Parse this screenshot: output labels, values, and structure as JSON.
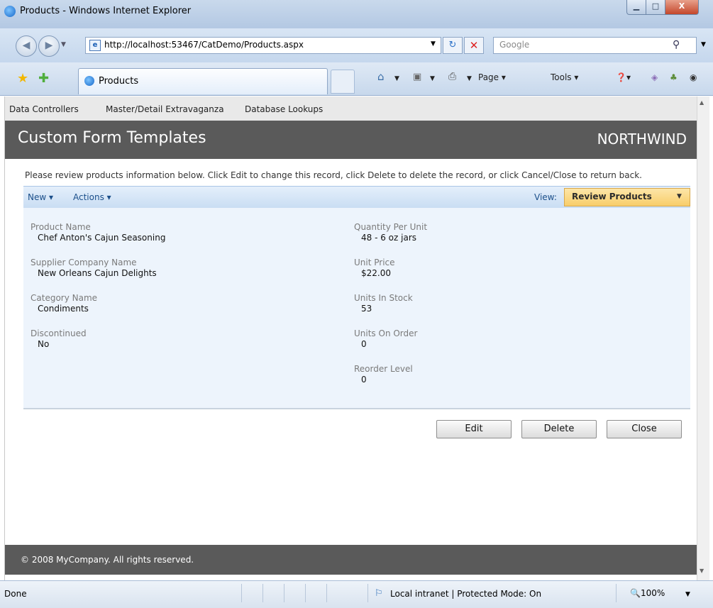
{
  "window": {
    "title": "Products - Windows Internet Explorer",
    "min_label": "▁",
    "max_label": "□",
    "close_label": "X"
  },
  "address_bar": {
    "url": "http://localhost:53467/CatDemo/Products.aspx",
    "search_placeholder": "Google"
  },
  "tab": {
    "label": "Products"
  },
  "command_bar": {
    "page_label": "Page ▾",
    "tools_label": "Tools ▾",
    "help_label": "❓▾"
  },
  "site_menu": {
    "items": [
      "Data Controllers",
      "Master/Detail Extravaganza",
      "Database Lookups"
    ]
  },
  "header": {
    "title": "Custom Form Templates",
    "brand": "NORTHWIND"
  },
  "instructions": "Please review products information below. Click Edit to change this record, click Delete to delete the record, or click Cancel/Close to return back.",
  "toolbar": {
    "new_label": "New ▾",
    "actions_label": "Actions ▾",
    "view_label": "View:",
    "view_value": "Review Products"
  },
  "form": {
    "left": [
      {
        "label": "Product Name",
        "value": "Chef Anton's Cajun Seasoning"
      },
      {
        "label": "Supplier Company Name",
        "value": "New Orleans Cajun Delights"
      },
      {
        "label": "Category Name",
        "value": "Condiments"
      },
      {
        "label": "Discontinued",
        "value": "No"
      }
    ],
    "right": [
      {
        "label": "Quantity Per Unit",
        "value": "48 - 6 oz jars"
      },
      {
        "label": "Unit Price",
        "value": "$22.00"
      },
      {
        "label": "Units In Stock",
        "value": "53"
      },
      {
        "label": "Units On Order",
        "value": "0"
      },
      {
        "label": "Reorder Level",
        "value": "0"
      }
    ]
  },
  "buttons": {
    "edit": "Edit",
    "delete": "Delete",
    "close": "Close"
  },
  "footer": "© 2008 MyCompany. All rights reserved.",
  "status_bar": {
    "status": "Done",
    "zone": "Local intranet | Protected Mode: On",
    "zoom": "100%"
  }
}
